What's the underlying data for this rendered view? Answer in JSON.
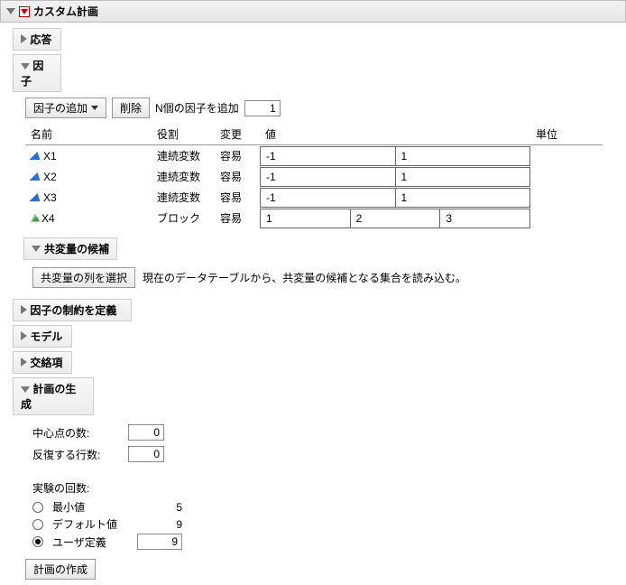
{
  "main": {
    "title": "カスタム計画"
  },
  "sections": {
    "responses": {
      "title": "応答"
    },
    "factors": {
      "title": "因子",
      "add_button": "因子の追加",
      "delete_button": "削除",
      "add_n_label": "N個の因子を追加",
      "add_n_value": "1",
      "columns": {
        "name": "名前",
        "role": "役割",
        "changes": "変更",
        "values": "値",
        "units": "単位"
      },
      "rows": [
        {
          "name": "X1",
          "role": "連続変数",
          "changes": "容易",
          "v1": "-1",
          "v2": "1",
          "v3": "",
          "type": "cont"
        },
        {
          "name": "X2",
          "role": "連続変数",
          "changes": "容易",
          "v1": "-1",
          "v2": "1",
          "v3": "",
          "type": "cont"
        },
        {
          "name": "X3",
          "role": "連続変数",
          "changes": "容易",
          "v1": "-1",
          "v2": "1",
          "v3": "",
          "type": "cont"
        },
        {
          "name": "X4",
          "role": "ブロック",
          "changes": "容易",
          "v1": "1",
          "v2": "2",
          "v3": "3",
          "type": "block"
        }
      ]
    },
    "covariate": {
      "title": "共変量の候補",
      "button": "共変量の列を選択",
      "text": "現在のデータテーブルから、共変量の候補となる集合を読み込む。"
    },
    "constraints": {
      "title": "因子の制約を定義"
    },
    "model": {
      "title": "モデル"
    },
    "alias": {
      "title": "交絡項"
    },
    "generate": {
      "title": "計画の生成",
      "center_label": "中心点の数:",
      "center_value": "0",
      "replicate_label": "反復する行数:",
      "replicate_value": "0",
      "runs_label": "実験の回数:",
      "min_label": "最小値",
      "min_value": "5",
      "default_label": "デフォルト値",
      "default_value": "9",
      "user_label": "ユーザ定義",
      "user_value": "9",
      "make_button": "計画の作成"
    }
  }
}
